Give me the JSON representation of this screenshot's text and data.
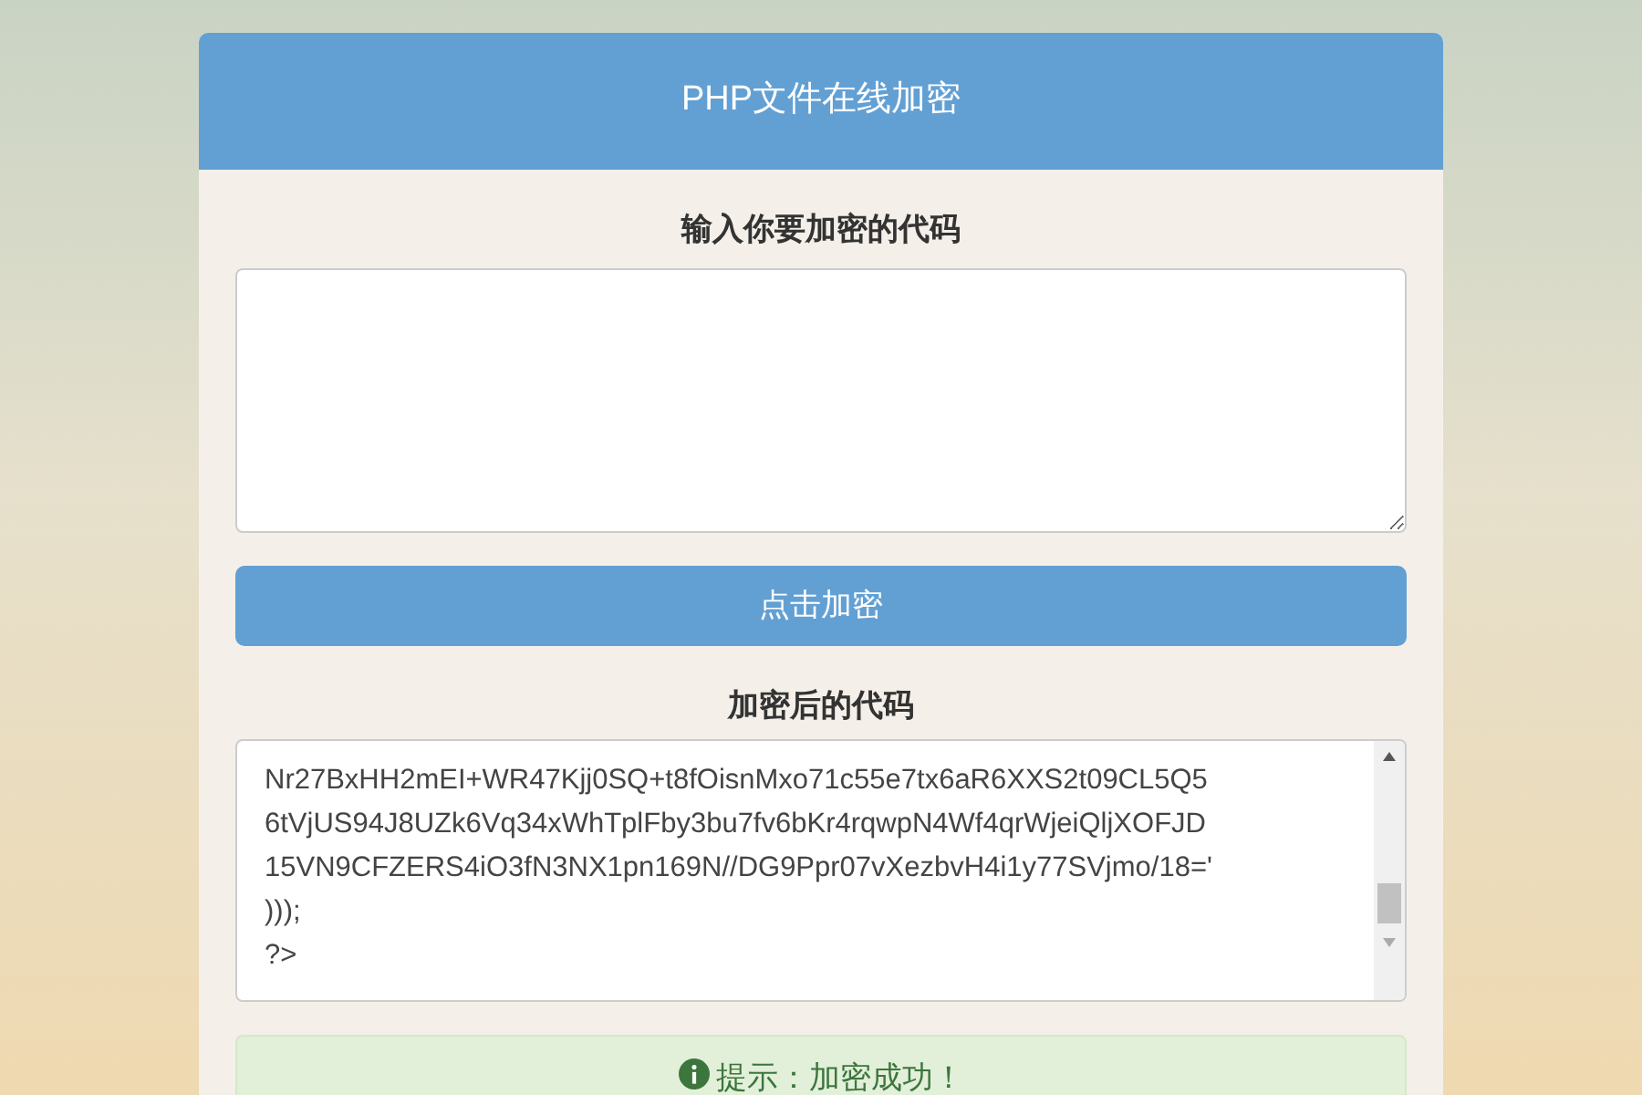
{
  "header": {
    "title": "PHP文件在线加密"
  },
  "input_section": {
    "label": "输入你要加密的代码"
  },
  "encrypt_button": {
    "label": "点击加密"
  },
  "output_section": {
    "label": "加密后的代码",
    "lines": [
      "Nr27BxHH2mEI+WR47Kjj0SQ+t8fOisnMxo71c55e7tx6aR6XXS2t09CL5Q5",
      "6tVjUS94J8UZk6Vq34xWhTplFby3bu7fv6bKr4rqwpN4Wf4qrWjeiQljXOFJD",
      "15VN9CFZERS4iO3fN3NX1pn169N//DG9Ppr07vXezbvH4i1y77SVjmo/18='",
      ")));",
      "?>"
    ]
  },
  "alert": {
    "text": "提示：加密成功！"
  }
}
